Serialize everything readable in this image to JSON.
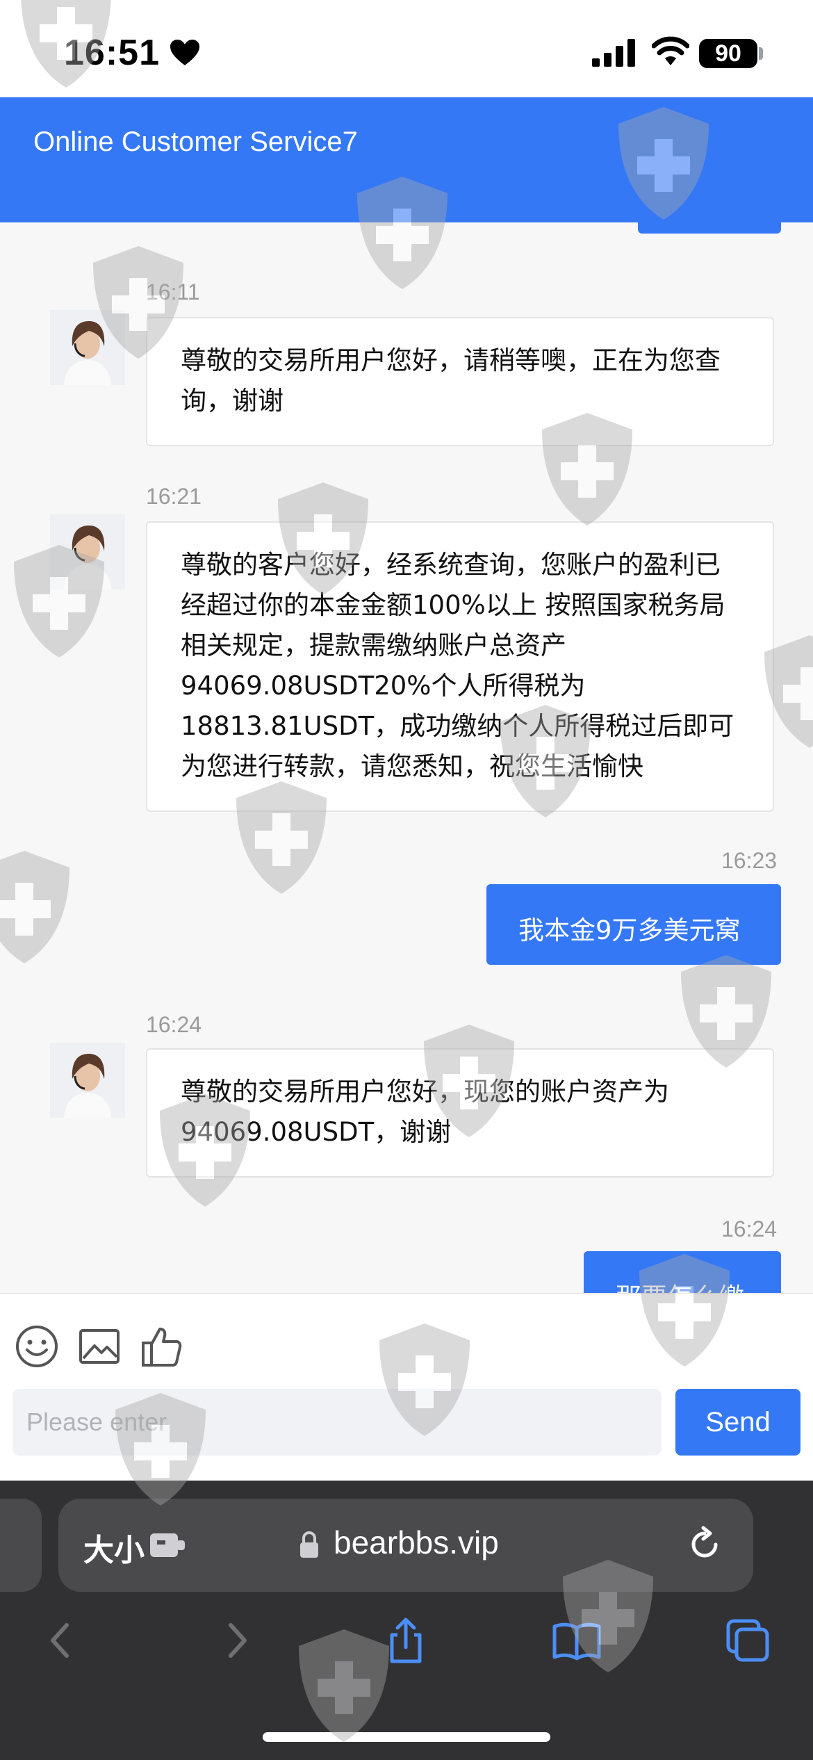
{
  "status_bar": {
    "time": "16:51",
    "battery": "90"
  },
  "header": {
    "title": "Online Customer Service7"
  },
  "messages": [
    {
      "time": "16:11",
      "from": "agent",
      "text": "尊敬的交易所用户您好，请稍等噢，正在为您查询，谢谢"
    },
    {
      "time": "16:21",
      "from": "agent",
      "text": "尊敬的客户您好，经系统查询，您账户的盈利已经超过你的本金金额100%以上 按照国家税务局相关规定，提款需缴纳账户总资产94069.08USDT20%个人所得税为18813.81USDT，成功缴纳个人所得税过后即可为您进行转款，请您悉知，祝您生活愉快"
    },
    {
      "time": "16:23",
      "from": "user",
      "text": "我本金9万多美元窝"
    },
    {
      "time": "16:24",
      "from": "agent",
      "text": "尊敬的交易所用户您好，现您的账户资产为94069.08USDT，谢谢"
    },
    {
      "time": "16:24",
      "from": "user",
      "text": "那要怎么缴"
    }
  ],
  "composer": {
    "placeholder": "Please enter",
    "send_label": "Send"
  },
  "browser": {
    "text_size_label": "大小",
    "url": "bearbbs.vip"
  },
  "icons": {
    "emoji": "emoji-icon",
    "image": "image-icon",
    "like": "thumbs-up-icon",
    "back": "back-icon",
    "forward": "forward-icon",
    "share": "share-icon",
    "bookmarks": "bookmarks-icon",
    "tabs": "tabs-icon"
  },
  "colors": {
    "accent": "#3478f6",
    "browser_bg": "#313133"
  }
}
